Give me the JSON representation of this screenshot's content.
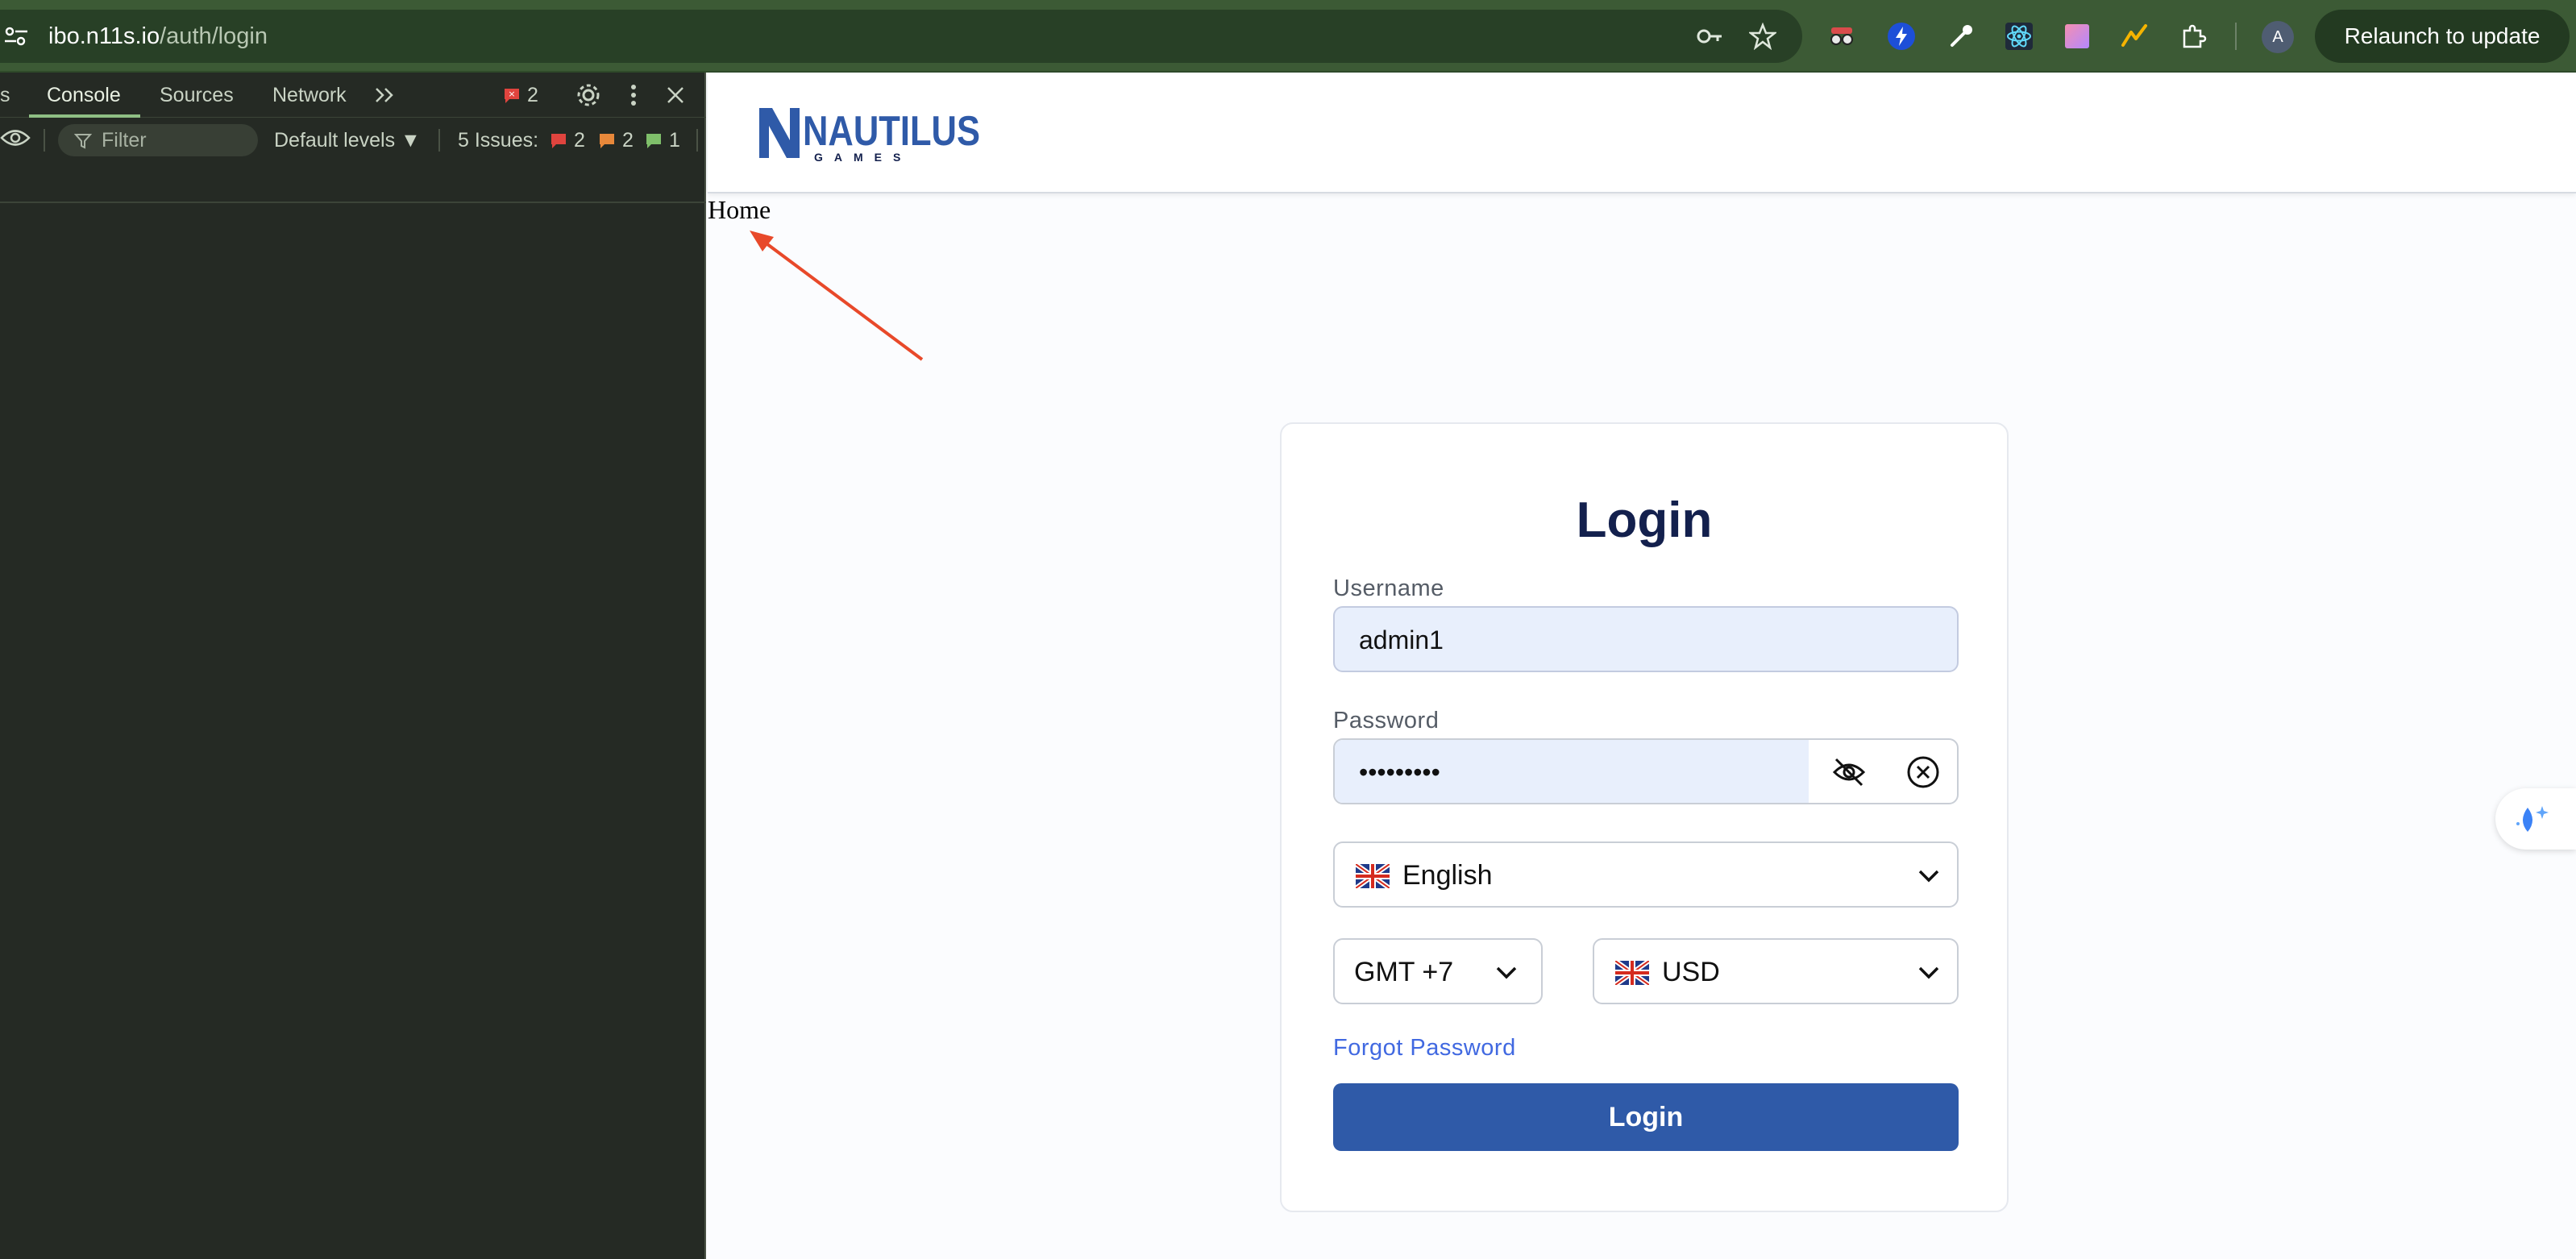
{
  "browser": {
    "url_host": "ibo.n11s.io",
    "url_path": "/auth/login",
    "relaunch_label": "Relaunch to update",
    "avatar_letter": "A"
  },
  "devtools": {
    "tabs": [
      {
        "label": "s"
      },
      {
        "label": "Console"
      },
      {
        "label": "Sources"
      },
      {
        "label": "Network"
      }
    ],
    "active_tab": "Console",
    "error_badge_count": "2",
    "filter_placeholder": "Filter",
    "levels_label": "Default levels ▼",
    "issues_label": "5 Issues:",
    "issues_counts": {
      "errors": "2",
      "warnings": "2",
      "info": "1"
    }
  },
  "page": {
    "home_text": "Home",
    "login": {
      "title": "Login",
      "username_label": "Username",
      "username_value": "admin1",
      "password_label": "Password",
      "password_value": "•••••••••",
      "language_value": "English",
      "timezone_value": "GMT +7",
      "currency_value": "USD",
      "forgot_password": "Forgot Password",
      "submit_label": "Login"
    }
  },
  "colors": {
    "browser_bar": "#3c5a35",
    "devtools_bg": "#252a24",
    "brand_navy": "#13204d",
    "login_button": "#2f5aa8",
    "link": "#4169e1",
    "arrow": "#e8492a"
  },
  "icons": {
    "site_info": "tune-icon",
    "omnibox_right": [
      "password-key-icon",
      "bookmark-star-icon"
    ],
    "extensions": [
      "spy-extension-icon",
      "lightning-extension-icon",
      "eyedropper-extension-icon",
      "react-devtools-icon",
      "gradient-extension-icon",
      "stroke-extension-icon",
      "puzzle-extensions-icon"
    ]
  }
}
